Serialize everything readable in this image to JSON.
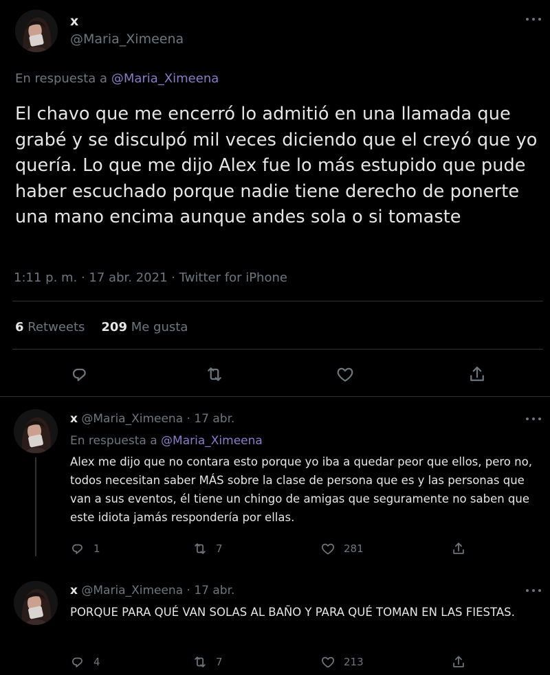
{
  "main_tweet": {
    "display_name": "x",
    "handle": "@Maria_Ximeena",
    "reply_prefix": "En respuesta a",
    "reply_handle": "@Maria_Ximeena",
    "text": "El chavo que me encerró lo admitió en una llamada que grabé y se disculpó mil veces diciendo que el creyó que yo quería. Lo que me dijo Alex fue lo más estupido que pude haber escuchado porque nadie tiene derecho de ponerte una mano encima aunque andes sola o si tomaste",
    "meta": "1:11 p. m. · 17 abr. 2021 · Twitter for iPhone",
    "retweets_count": "6",
    "retweets_label": "Retweets",
    "likes_count": "209",
    "likes_label": "Me gusta"
  },
  "replies": [
    {
      "display_name": "x",
      "handle_date": "@Maria_Ximeena · 17 abr.",
      "reply_prefix": "En respuesta a",
      "reply_handle": "@Maria_Ximeena",
      "text": "Alex me dijo que no contara esto porque yo iba a quedar peor que ellos, pero no, todos necesitan saber MÁS sobre la clase de persona que es y las personas que van a sus eventos, él tiene un chingo de amigas que seguramente no saben que este idiota jamás respondería por ellas.",
      "replies": "1",
      "retweets": "7",
      "likes": "281"
    },
    {
      "display_name": "x",
      "handle_date": "@Maria_Ximeena · 17 abr.",
      "text": "PORQUE PARA QUÉ VAN SOLAS AL BAÑO Y PARA QUÉ TOMAN EN LAS FIESTAS.",
      "replies": "4",
      "retweets": "7",
      "likes": "213"
    }
  ],
  "colors": {
    "background": "#000000",
    "text": "#e6e6e6",
    "muted": "#6e767d",
    "mention": "#8b7cc8",
    "divider": "#2f3336"
  },
  "icons": [
    "more-icon",
    "reply-icon",
    "retweet-icon",
    "like-icon",
    "share-icon"
  ]
}
